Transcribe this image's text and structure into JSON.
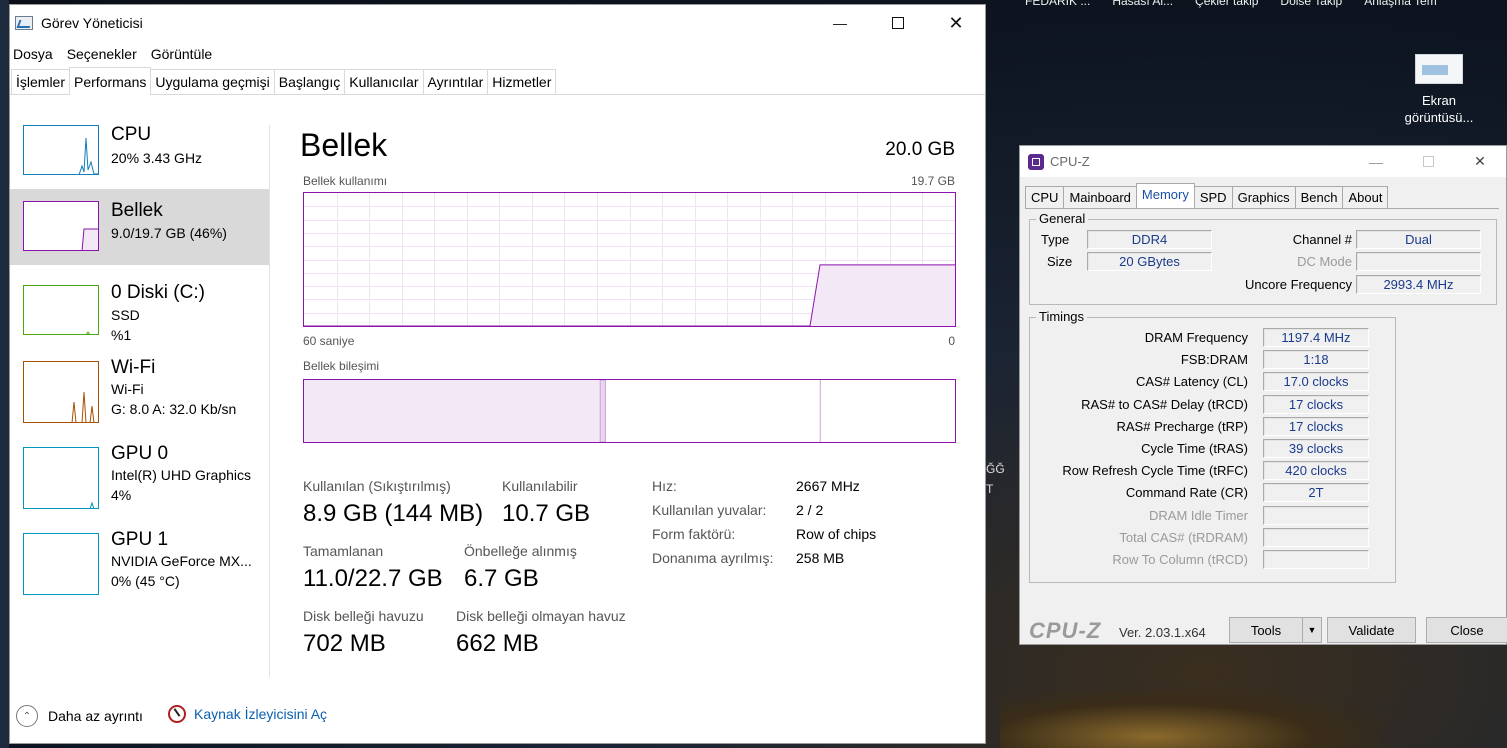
{
  "desktop": {
    "top_strip": [
      "FEDARIK ...",
      "Hasası Al...",
      "Çekler takip",
      "Dolse Takip",
      "Anlaşma Tem"
    ],
    "icon_label": "Ekran görüntüsü...",
    "partial_texts": [
      "ĞĞ",
      "T"
    ]
  },
  "task_manager": {
    "title": "Görev Yöneticisi",
    "menu": [
      "Dosya",
      "Seçenekler",
      "Görüntüle"
    ],
    "tabs": [
      "İşlemler",
      "Performans",
      "Uygulama geçmişi",
      "Başlangıç",
      "Kullanıcılar",
      "Ayrıntılar",
      "Hizmetler"
    ],
    "active_tab": "Performans",
    "sidebar": [
      {
        "name": "CPU",
        "line1": "20%  3.43 GHz",
        "line2": "",
        "color": "#117dbb"
      },
      {
        "name": "Bellek",
        "line1": "9.0/19.7 GB (46%)",
        "line2": "",
        "color": "#8b12ae"
      },
      {
        "name": "0 Diski (C:)",
        "line1": "SSD",
        "line2": "%1",
        "color": "#4da60c"
      },
      {
        "name": "Wi-Fi",
        "line1": "Wi-Fi",
        "line2": "G: 8.0  A: 32.0 Kb/sn",
        "color": "#a74f01"
      },
      {
        "name": "GPU 0",
        "line1": "Intel(R) UHD Graphics",
        "line2": "4%",
        "color": "#0097c2"
      },
      {
        "name": "GPU 1",
        "line1": "NVIDIA GeForce MX...",
        "line2": "0% (45 °C)",
        "color": "#0097c2"
      }
    ],
    "memory": {
      "title": "Bellek",
      "total": "20.0 GB",
      "usage_label": "Bellek kullanımı",
      "usage_max": "19.7 GB",
      "time_left": "60 saniye",
      "time_right": "0",
      "composition_label": "Bellek bileşimi",
      "usage_fraction_current": 0.46,
      "composition": {
        "in_use_fraction": 0.455,
        "modified_fraction": 0.008,
        "standby_fraction": 0.33
      },
      "stats": {
        "used_label": "Kullanılan (Sıkıştırılmış)",
        "used_value": "8.9 GB (144 MB)",
        "available_label": "Kullanılabilir",
        "available_value": "10.7 GB",
        "committed_label": "Tamamlanan",
        "committed_value": "11.0/22.7 GB",
        "cached_label": "Önbelleğe alınmış",
        "cached_value": "6.7 GB",
        "paged_label": "Disk belleği havuzu",
        "paged_value": "702 MB",
        "nonpaged_label": "Disk belleği olmayan havuz",
        "nonpaged_value": "662 MB"
      },
      "details": [
        {
          "k": "Hız:",
          "v": "2667 MHz"
        },
        {
          "k": "Kullanılan yuvalar:",
          "v": "2 / 2"
        },
        {
          "k": "Form faktörü:",
          "v": "Row of chips"
        },
        {
          "k": "Donanıma ayrılmış:",
          "v": "258 MB"
        }
      ]
    },
    "footer": {
      "fewer": "Daha az ayrıntı",
      "resmon": "Kaynak İzleyicisini Aç"
    }
  },
  "cpuz": {
    "title": "CPU-Z",
    "tabs": [
      "CPU",
      "Mainboard",
      "Memory",
      "SPD",
      "Graphics",
      "Bench",
      "About"
    ],
    "active_tab": "Memory",
    "general": {
      "title": "General",
      "type_label": "Type",
      "type_value": "DDR4",
      "size_label": "Size",
      "size_value": "20 GBytes",
      "channel_label": "Channel #",
      "channel_value": "Dual",
      "dcmode_label": "DC Mode",
      "dcmode_value": "",
      "uncore_label": "Uncore Frequency",
      "uncore_value": "2993.4 MHz"
    },
    "timings": {
      "title": "Timings",
      "rows": [
        {
          "k": "DRAM Frequency",
          "v": "1197.4 MHz",
          "dis": false
        },
        {
          "k": "FSB:DRAM",
          "v": "1:18",
          "dis": false
        },
        {
          "k": "CAS# Latency (CL)",
          "v": "17.0 clocks",
          "dis": false
        },
        {
          "k": "RAS# to CAS# Delay (tRCD)",
          "v": "17 clocks",
          "dis": false
        },
        {
          "k": "RAS# Precharge (tRP)",
          "v": "17 clocks",
          "dis": false
        },
        {
          "k": "Cycle Time (tRAS)",
          "v": "39 clocks",
          "dis": false
        },
        {
          "k": "Row Refresh Cycle Time (tRFC)",
          "v": "420 clocks",
          "dis": false
        },
        {
          "k": "Command Rate (CR)",
          "v": "2T",
          "dis": false
        },
        {
          "k": "DRAM Idle Timer",
          "v": "",
          "dis": true
        },
        {
          "k": "Total CAS# (tRDRAM)",
          "v": "",
          "dis": true
        },
        {
          "k": "Row To Column (tRCD)",
          "v": "",
          "dis": true
        }
      ]
    },
    "bottom": {
      "logo": "CPU-Z",
      "version": "Ver. 2.03.1.x64",
      "tools": "Tools",
      "validate": "Validate",
      "close": "Close"
    }
  }
}
